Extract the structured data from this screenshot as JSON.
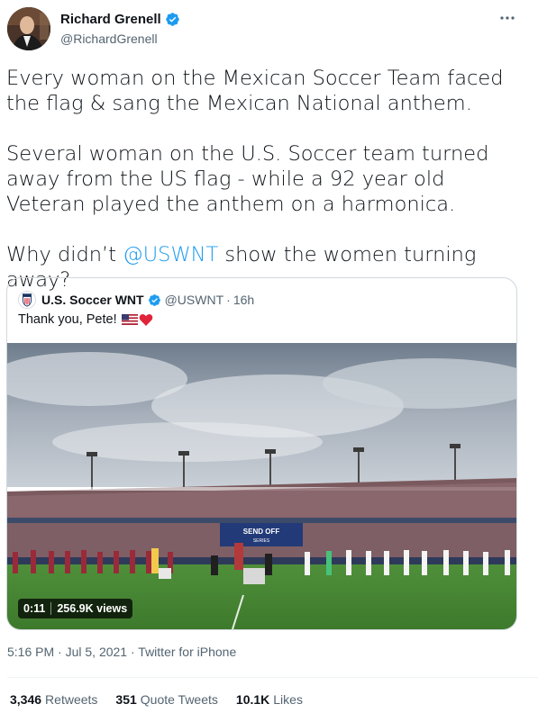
{
  "author": {
    "display_name": "Richard Grenell",
    "handle": "@RichardGrenell",
    "avatar_icon": "profile-photo",
    "verified_icon": "verified-badge-icon",
    "verified_color": "#1d9bf0"
  },
  "more_icon": "more-options-icon",
  "tweet": {
    "p1": "Every woman on the Mexican Soccer Team faced the flag & sang the Mexican National anthem.",
    "p2": "Several woman on the U.S. Soccer team turned away from the US flag - while a 92 year old Veteran played the anthem on a harmonica.",
    "p3_before": "Why didn’t ",
    "p3_mention": "@USWNT",
    "p3_after": " show the women turning away?"
  },
  "quote": {
    "display_name": "U.S. Soccer WNT",
    "handle": "@USWNT",
    "separator": "·",
    "time": "16h",
    "text": "Thank you, Pete!",
    "emojis": [
      "us-flag-emoji",
      "red-heart-emoji"
    ],
    "video": {
      "duration": "0:11",
      "views": "256.9K views",
      "banner_text": "SEND OFF",
      "banner_sub": "SERIES"
    }
  },
  "meta": {
    "time": "5:16 PM",
    "separator1": "·",
    "date": "Jul 5, 2021",
    "separator2": "·",
    "source": "Twitter for iPhone"
  },
  "stats": {
    "retweets_count": "3,346",
    "retweets_label": "Retweets",
    "quotes_count": "351",
    "quotes_label": "Quote Tweets",
    "likes_count": "10.1K",
    "likes_label": "Likes"
  },
  "colors": {
    "link": "#1d9bf0",
    "text": "#0f1419",
    "secondary": "#536471",
    "border": "#cfd9de"
  }
}
